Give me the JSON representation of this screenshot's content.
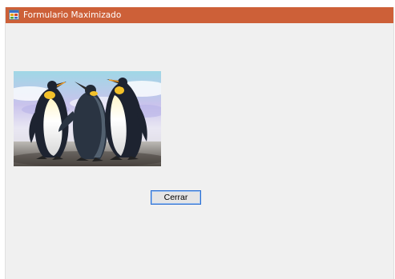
{
  "window": {
    "title": "Formulario Maximizado",
    "icon": "windows-form-icon",
    "titlebar_color": "#cd6038"
  },
  "picture": {
    "description_icon": "penguins-image"
  },
  "buttons": {
    "close_label": "Cerrar",
    "focus_border_color": "#2b6fd2"
  }
}
